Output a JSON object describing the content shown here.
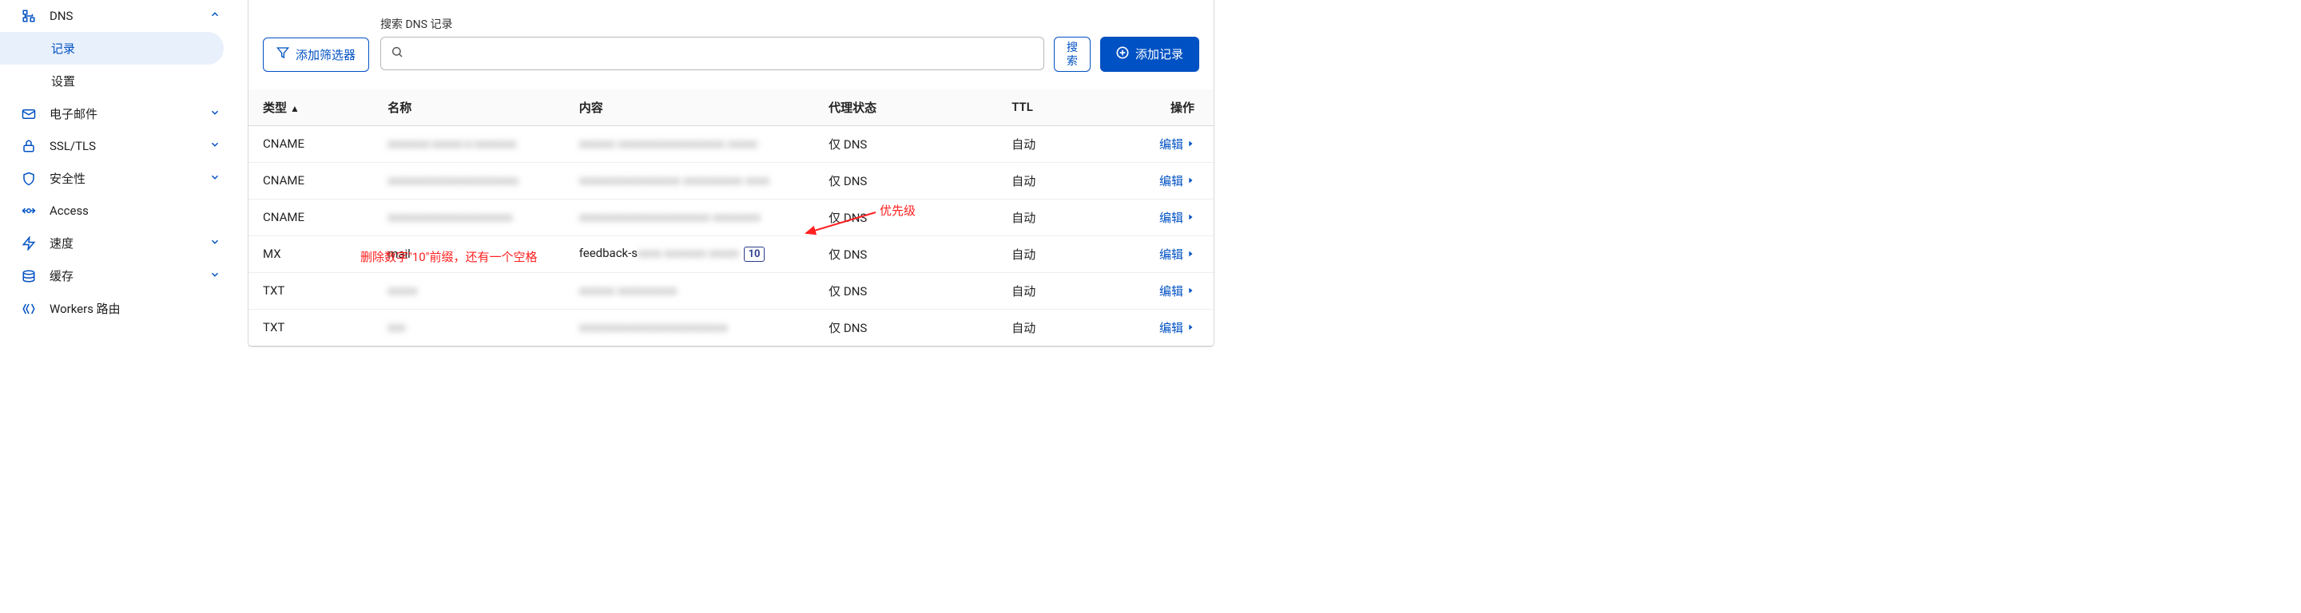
{
  "sidebar": {
    "items": [
      {
        "label": "DNS",
        "icon": "network",
        "expanded": true,
        "children": [
          {
            "label": "记录",
            "active": true
          },
          {
            "label": "设置",
            "active": false
          }
        ]
      },
      {
        "label": "电子邮件",
        "icon": "mail"
      },
      {
        "label": "SSL/TLS",
        "icon": "lock"
      },
      {
        "label": "安全性",
        "icon": "shield"
      },
      {
        "label": "Access",
        "icon": "access"
      },
      {
        "label": "速度",
        "icon": "bolt"
      },
      {
        "label": "缓存",
        "icon": "cache"
      },
      {
        "label": "Workers 路由",
        "icon": "workers"
      }
    ]
  },
  "toolbar": {
    "filter_label": "添加筛选器",
    "search_label": "搜索 DNS 记录",
    "search_placeholder": "",
    "search_btn": "搜索",
    "add_record": "添加记录"
  },
  "table": {
    "headers": {
      "type": "类型",
      "name": "名称",
      "content": "内容",
      "proxy": "代理状态",
      "ttl": "TTL",
      "actions": "操作"
    },
    "edit_label": "编辑",
    "rows": [
      {
        "type": "CNAME",
        "name_blur": "xxxxxxx-xxxxx-x-xxxxxxx",
        "content_blur": "xxxxxx xxxxxxxxxxxxxxxxxx xxxxx",
        "proxy": "仅 DNS",
        "ttl": "自动"
      },
      {
        "type": "CNAME",
        "name_blur": "xxxxxxxxxxxxxxxxxxxxxx",
        "content_blur": "xxxxxxxxxxxxxxxxx xxxxxxxxxx xxxx",
        "proxy": "仅 DNS",
        "ttl": "自动"
      },
      {
        "type": "CNAME",
        "name_blur": "xxxxxxxxxxxxxxxxxxxxx",
        "content_blur": "xxxxxxxxxxxxxxxxxxxxxx xxxxxxxx",
        "proxy": "仅 DNS",
        "ttl": "自动"
      },
      {
        "type": "MX",
        "name": "mail",
        "content_prefix": "feedback-s",
        "content_blur_suffix": "xxxx xxxxxxx xxxxx",
        "priority": "10",
        "proxy": "仅 DNS",
        "ttl": "自动"
      },
      {
        "type": "TXT",
        "name_blur": "xxxxx",
        "content_blur": "xxxxxx xxxxxxxxxx",
        "proxy": "仅 DNS",
        "ttl": "自动"
      },
      {
        "type": "TXT",
        "name_blur": "xxx",
        "content_blur": "xxxxxxxxxxxxxxxxxxxxxxxxx",
        "proxy": "仅 DNS",
        "ttl": "自动"
      }
    ]
  },
  "annotations": {
    "priority_label": "优先级",
    "delete_hint": "删除数字\"10\"前缀，还有一个空格"
  }
}
